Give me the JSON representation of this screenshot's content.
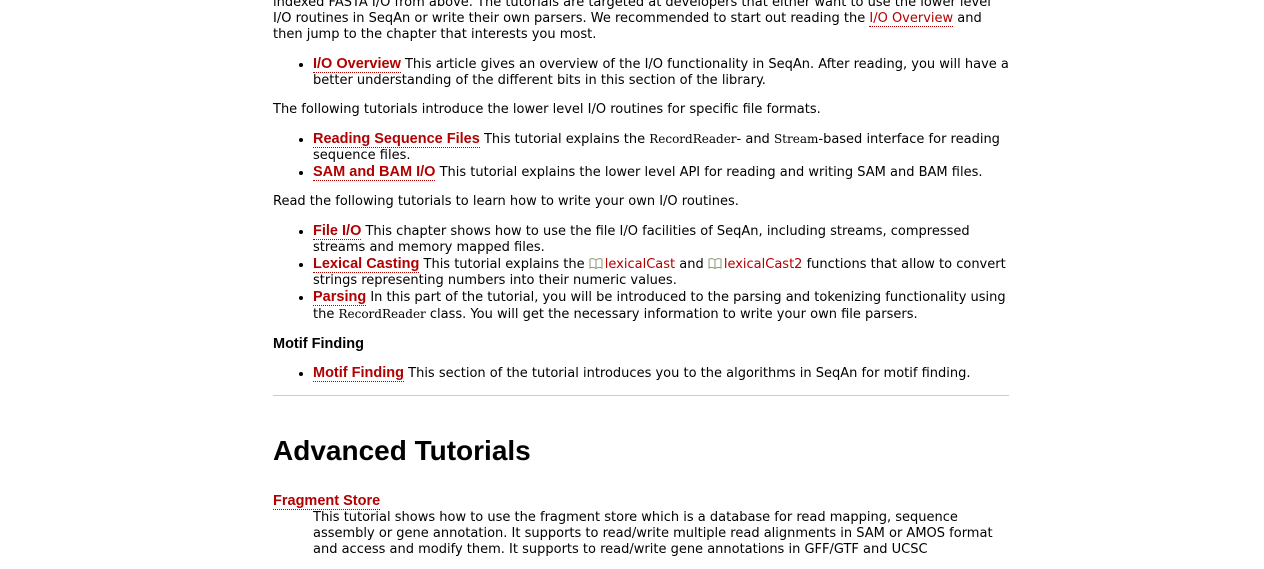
{
  "intro": {
    "text_before": "indexed FASTA I/O from above. The tutorials are targeted at developers that either want to use the lower level I/O routines in SeqAn or write their own parsers. We recommended to start out reading the ",
    "link": "I/O Overview",
    "text_after": " and then jump to the chapter that interests you most."
  },
  "overview_list": [
    {
      "title": "I/O Overview",
      "desc": " This article gives an overview of the I/O functionality in SeqAn. After reading, you will have a better understanding of the different bits in this section of the library."
    }
  ],
  "lower_level_intro": "The following tutorials introduce the lower level I/O routines for specific file formats.",
  "reading_seq": {
    "title": "Reading Sequence Files",
    "desc_a": " This tutorial explains the ",
    "code_a": "RecordReader",
    "desc_b": "- and ",
    "code_b": "Stream",
    "desc_c": "-based interface for reading sequence files."
  },
  "sam_bam": {
    "title": "SAM and BAM I/O",
    "desc": " This tutorial explains the lower level API for reading and writing SAM and BAM files."
  },
  "own_io_intro": "Read the following tutorials to learn how to write your own I/O routines.",
  "file_io": {
    "title": "File I/O",
    "desc": " This chapter shows how to use the file I/O facilities of SeqAn, including streams, compressed streams and memory mapped files."
  },
  "lexical": {
    "title": "Lexical Casting",
    "desc_a": " This tutorial explains the ",
    "link_a": "lexicalCast",
    "desc_b": " and ",
    "link_b": "lexicalCast2",
    "desc_c": " functions that allow to convert strings representing numbers into their numeric values."
  },
  "parsing": {
    "title": "Parsing",
    "desc_a": " In this part of the tutorial, you will be introduced to the parsing and tokenizing functionality using the ",
    "code": "RecordReader",
    "desc_b": " class. You will get the necessary information to write your own file parsers."
  },
  "motif": {
    "heading": "Motif Finding",
    "title": "Motif Finding",
    "desc": " This section of the tutorial introduces you to the algorithms in SeqAn for motif finding."
  },
  "advanced": {
    "heading": "Advanced Tutorials",
    "fragment_title": "Fragment Store",
    "fragment_desc": "This tutorial shows how to use the fragment store which is a database for read mapping, sequence assembly or gene annotation. It supports to read/write multiple read alignments in SAM or AMOS format and access and modify them. It supports to read/write gene annotations in GFF/GTF and UCSC"
  },
  "colors": {
    "link": "#b10000",
    "rule": "#cccccc",
    "icon": "#8a9a70"
  },
  "icons": {
    "doc_link": "book-icon"
  }
}
